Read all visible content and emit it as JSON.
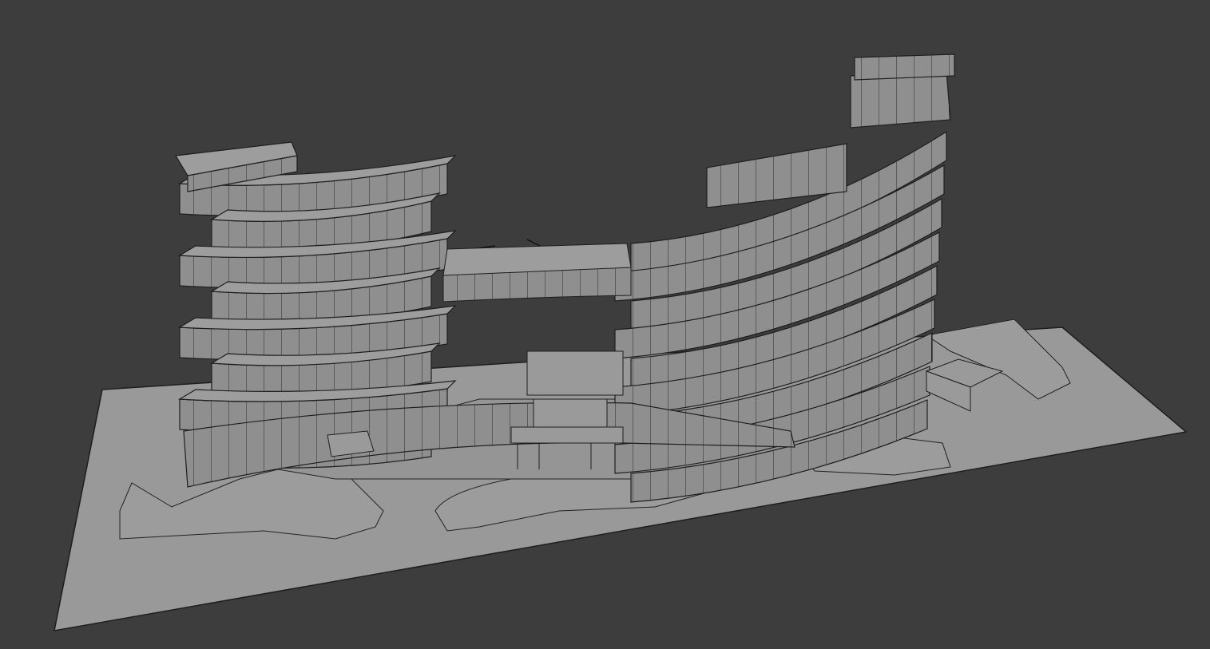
{
  "viewport": {
    "background_color": "#3d3d3d",
    "surface_color": "#999999",
    "facade_color": "#8f8f8f",
    "edge_color": "#1e1e1e"
  }
}
